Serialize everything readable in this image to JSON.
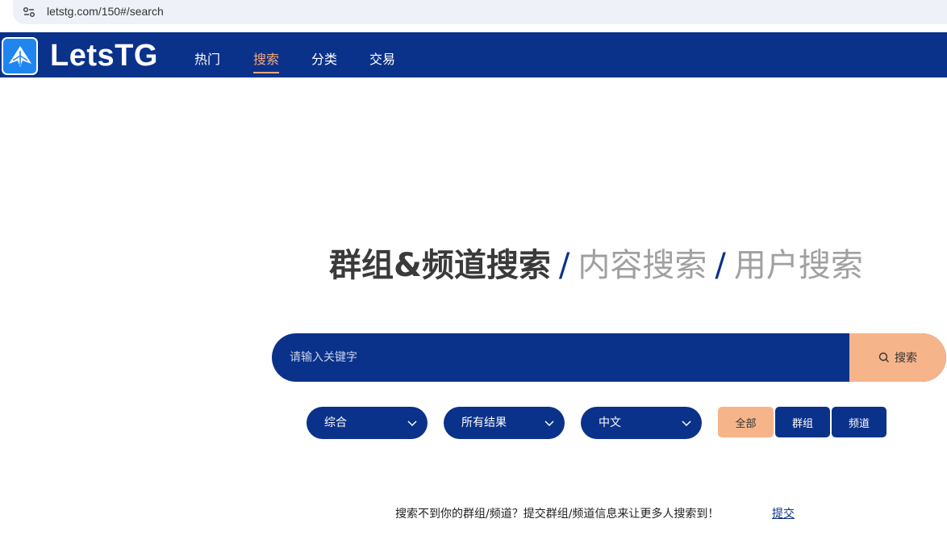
{
  "browser": {
    "url": "letstg.com/150#/search",
    "settings_icon": "tune-icon"
  },
  "brand": {
    "name": "LetsTG",
    "logo_icon": "paper-plane-icon",
    "nav_bg": "#0b328a",
    "accent": "#f6a87a"
  },
  "nav": {
    "items": [
      {
        "label": "热门",
        "active": false
      },
      {
        "label": "搜索",
        "active": true
      },
      {
        "label": "分类",
        "active": false
      },
      {
        "label": "交易",
        "active": false
      }
    ]
  },
  "hero": {
    "main": "群组&频道搜索",
    "separator": "/",
    "alt1": "内容搜索",
    "alt2": "用户搜索"
  },
  "search": {
    "placeholder": "请输入关键字",
    "value": "",
    "button_label": "搜索",
    "button_icon": "search-icon"
  },
  "filters": {
    "sort": {
      "selected": "综合"
    },
    "result_scope": {
      "selected": "所有结果"
    },
    "language": {
      "selected": "中文"
    },
    "types": [
      {
        "label": "全部",
        "active": true
      },
      {
        "label": "群组",
        "active": false
      },
      {
        "label": "频道",
        "active": false
      }
    ]
  },
  "prompt": {
    "text": "搜索不到你的群组/频道？提交群组/频道信息来让更多人搜索到！",
    "link": "提交"
  }
}
